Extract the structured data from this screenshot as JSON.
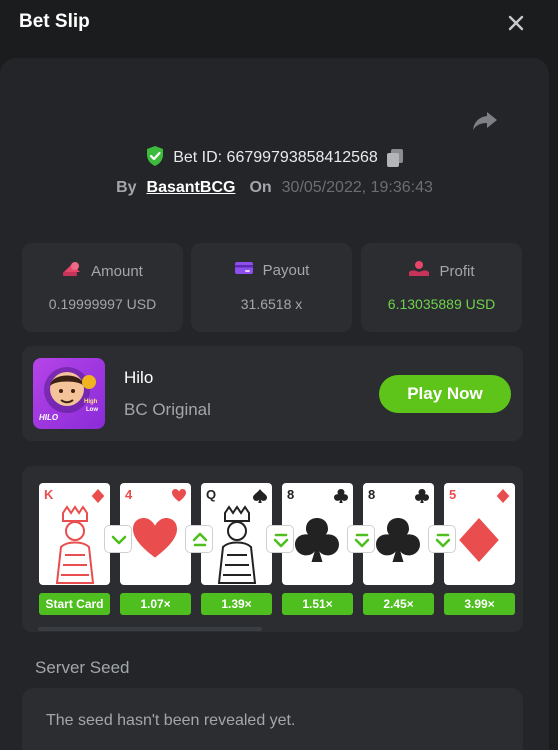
{
  "header": {
    "title": "Bet Slip"
  },
  "bet": {
    "bet_id_text": "Bet ID: 66799793858412568",
    "by_label": "By",
    "user": "BasantBCG",
    "on_label": "On",
    "date": "30/05/2022, 19:36:43"
  },
  "stats": [
    {
      "label": "Amount",
      "value": "0.19999997 USD",
      "icon": "amount-icon"
    },
    {
      "label": "Payout",
      "value": "31.6518 x",
      "icon": "payout-icon"
    },
    {
      "label": "Profit",
      "value": "6.13035889 USD",
      "icon": "profit-icon"
    }
  ],
  "game": {
    "name": "Hilo",
    "subtitle": "BC Original",
    "play_label": "Play Now",
    "thumb_text_top": "High",
    "thumb_text_bottom": "Low",
    "thumb_brand": "HILO"
  },
  "cards": [
    {
      "rank": "K",
      "suit": "diamond",
      "color": "red",
      "multiplier": "Start Card"
    },
    {
      "rank": "4",
      "suit": "heart",
      "color": "red",
      "multiplier": "1.07×"
    },
    {
      "rank": "Q",
      "suit": "spade",
      "color": "black",
      "multiplier": "1.39×"
    },
    {
      "rank": "8",
      "suit": "club",
      "color": "black",
      "multiplier": "1.51×"
    },
    {
      "rank": "8",
      "suit": "club",
      "color": "black",
      "multiplier": "2.45×"
    },
    {
      "rank": "5",
      "suit": "diamond",
      "color": "red",
      "multiplier": "3.99×"
    }
  ],
  "guesses": [
    "lower",
    "higher-or-equal",
    "lower-or-equal",
    "lower-or-equal",
    "lower-or-equal"
  ],
  "server_seed": {
    "label": "Server Seed",
    "value": "The seed hasn't been revealed yet."
  },
  "colors": {
    "accent_green": "#5fc41a",
    "profit_green": "#6fd34b",
    "shield_green": "#3dbb3d",
    "panel": "#2b2d31",
    "background": "#1b1c1e"
  }
}
